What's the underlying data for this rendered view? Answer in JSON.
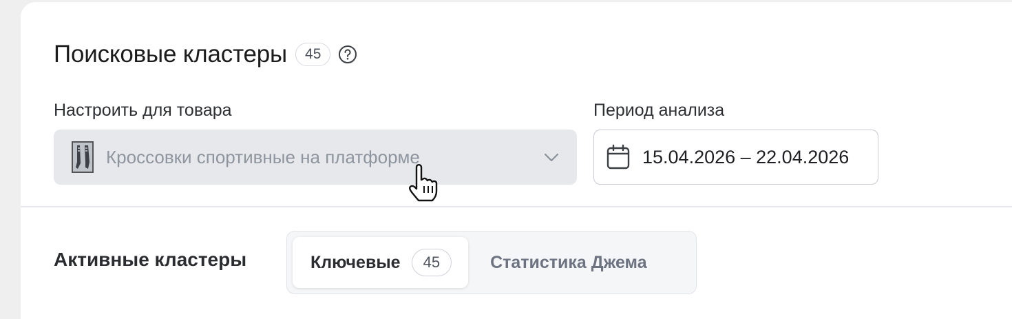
{
  "header": {
    "title": "Поисковые кластеры",
    "count": "45",
    "help_icon": "question-circle-icon"
  },
  "product": {
    "label": "Настроить для товара",
    "value": "Кроссовки спортивные на платформе",
    "disabled": true,
    "thumbnail_icon": "product-thumbnail",
    "dropdown_icon": "chevron-down-icon"
  },
  "period": {
    "label": "Период анализа",
    "value": "15.04.2026 – 22.04.2026",
    "icon": "calendar-icon"
  },
  "clusters": {
    "title": "Активные кластеры",
    "tabs": [
      {
        "label": "Ключевые",
        "count": "45",
        "active": true
      },
      {
        "label": "Статистика Джема",
        "active": false
      }
    ]
  },
  "colors": {
    "page_bg": "#efefef",
    "card_bg": "#ffffff",
    "disabled_field_bg": "#e6e8ec",
    "muted_text": "#8f959e",
    "border": "#c9ccd2"
  }
}
